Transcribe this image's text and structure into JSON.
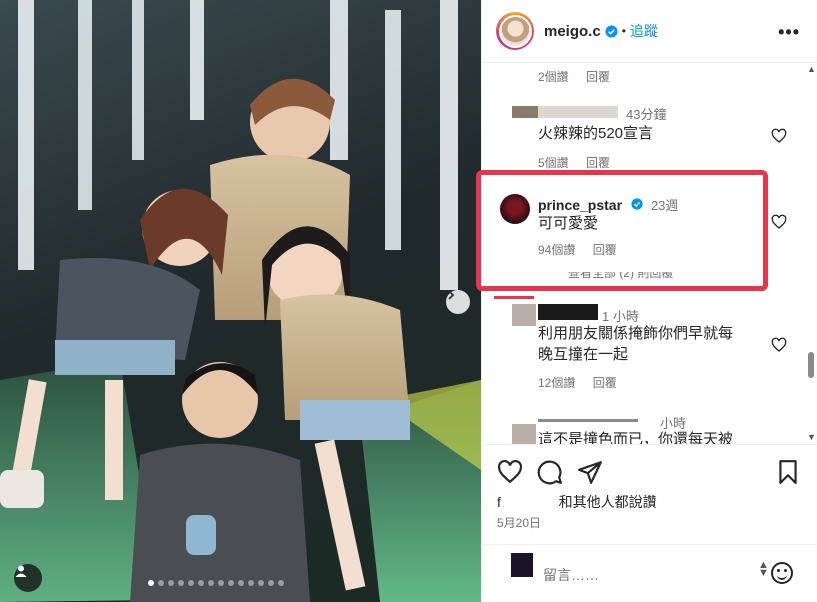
{
  "post": {
    "username": "meigo.c",
    "separator": "•",
    "follow_label": "追蹤",
    "more_label": "•••",
    "carousel_pages": 14,
    "carousel_current": 1
  },
  "comments": [
    {
      "likes": "2個讚",
      "reply": "回覆"
    },
    {
      "time": "43分鐘",
      "text": "火辣辣的520宣言",
      "likes": "5個讚",
      "reply": "回覆"
    },
    {
      "username": "prince_pstar",
      "time": "23週",
      "text": "可可愛愛",
      "likes": "94個讚",
      "reply": "回覆",
      "replies_partial": "查看全部 (2) 則回覆"
    },
    {
      "time": "1 小時",
      "text_line1": "利用朋友關係掩飾你們早就每",
      "text_line2": "晚互撞在一起",
      "likes": "12個讚",
      "reply": "回覆"
    },
    {
      "time": "小時",
      "text": "這不是撞色而已，你還每天被"
    }
  ],
  "footer": {
    "likes_prefix": "f",
    "likes_text": "和其他人都說讚",
    "date": "5月20日",
    "comment_placeholder": "留言……"
  },
  "colors": {
    "highlight": "#e8344e",
    "follow": "#0095f6",
    "verified": "#0095f6"
  },
  "icons": [
    "chevron-right-icon",
    "person-tag-icon",
    "heart-icon",
    "comment-icon",
    "share-icon",
    "bookmark-icon",
    "emoji-icon",
    "verified-icon"
  ]
}
